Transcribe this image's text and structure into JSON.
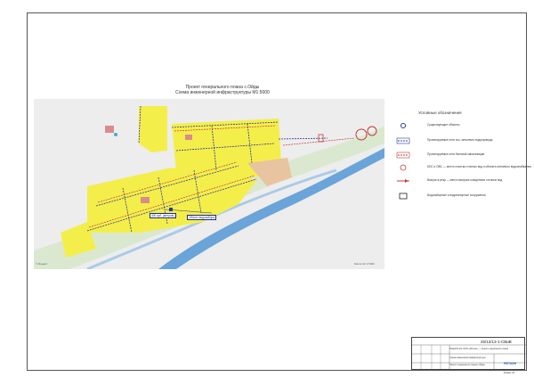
{
  "sheet": {
    "title_line1": "Проект генерального плана с.Ойды",
    "title_line2": "Схема инженерной инфраструктуры М1:5000",
    "doc_code": "25/12/13-1-СВиВ"
  },
  "map": {
    "label_tank": "400 куб. (метров)",
    "label_intake": "Объект водозабора",
    "copyright": "© Яндекс",
    "scale": "Масштаб 1:5000"
  },
  "legend": {
    "title": "Условные обозначения",
    "items": [
      {
        "text": "Существующие объекты",
        "icon": "blue-circle-icon"
      },
      {
        "text": "Проектируемые сети хоз.-питьевого водопровода",
        "icon": "dashed-blue-line-icon"
      },
      {
        "text": "Проектируемые сети бытовой канализации",
        "icon": "dashed-red-line-icon"
      },
      {
        "text": "КОС и ОВС — место очистки сточных вод и объекта питьевого водоснабжения",
        "icon": "red-ring-icon"
      },
      {
        "text": "Выпуск в реку — место выпуска очищенных сточных вод",
        "icon": "outlet-arrow-icon"
      },
      {
        "text": "Водозаборные и водонапорные сооружения",
        "icon": "intake-box-icon"
      }
    ]
  },
  "stamp": {
    "org": "Разработчик: ООО «Регион» — проект генерального плана",
    "sheet_name": "Схема инженерной инфраструктуры",
    "project": "Проект генерального плана с.Ойды",
    "logo": "РЕГИОН",
    "format": "Формат А3"
  },
  "colors": {
    "settlement": "#f4ee4a",
    "water_network": "#2b3a9a",
    "sewer_network": "#c43a3a",
    "river": "#6aa4d8",
    "terrain": "#ececec"
  }
}
